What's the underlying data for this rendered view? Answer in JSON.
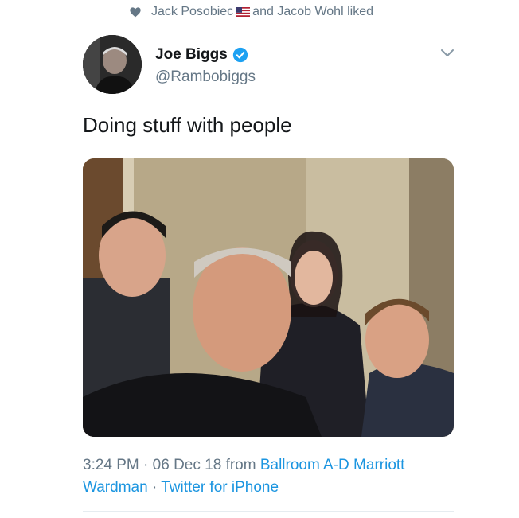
{
  "social_context": {
    "user1": "Jack Posobiec",
    "connector": "and",
    "user2": "Jacob Wohl",
    "action": "liked",
    "icon": "heart-icon",
    "flag_icon": "us-flag-icon"
  },
  "tweet": {
    "display_name": "Joe Biggs",
    "handle": "@Rambobiggs",
    "verified_icon": "verified-badge-icon",
    "text": "Doing stuff with people",
    "time": "3:24 PM",
    "sep1": "·",
    "date": "06 Dec 18",
    "from_word": "from",
    "place": "Ballroom A-D Marriott Wardman",
    "sep2": "·",
    "source": "Twitter for iPhone"
  },
  "colors": {
    "link": "#1b95e0",
    "secondary": "#657786",
    "primary": "#14171a",
    "verified": "#1da1f2"
  }
}
